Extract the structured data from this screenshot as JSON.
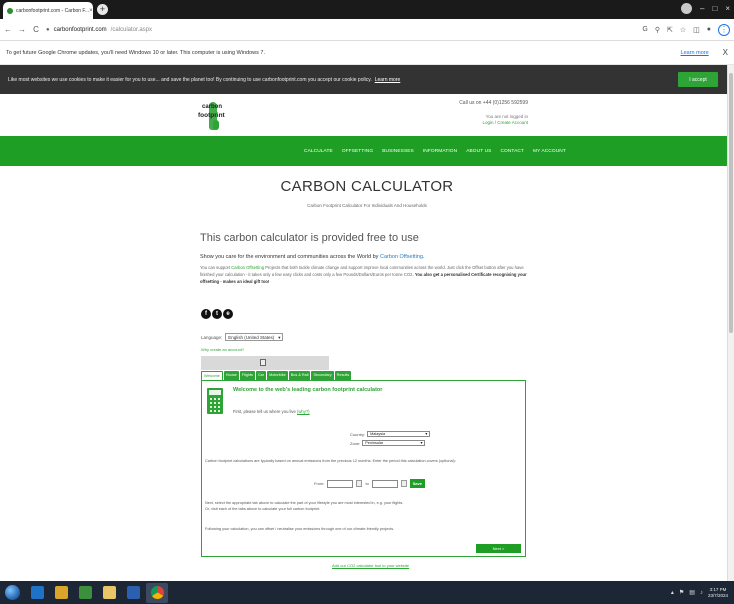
{
  "browser": {
    "tab_title": "carbonfootprint.com - Carbon F...",
    "tab_close": "×",
    "new_tab": "+",
    "url_host": "carbonfootprint.com",
    "url_path": "/calculator.aspx",
    "back": "←",
    "forward": "→",
    "reload": "C",
    "win_min": "–",
    "win_max": "□",
    "win_close": "×",
    "info_message": "To get future Google Chrome updates, you'll need Windows 10 or later. This computer is using Windows 7.",
    "info_learn": "Learn more",
    "info_close": "X"
  },
  "cookie": {
    "message": "Like most websites we use cookies to make it easier for you to use... and save the planet too! By continuing to use carbonfootprint.com you accept our cookie policy.",
    "policy_link": "Learn more",
    "accept": "I accept"
  },
  "header": {
    "logo_line1": "carbon",
    "logo_line2": "footprint",
    "call_us": "Call us on +44 (0)1256 592599",
    "login_status": "You are not logged in",
    "login_links": "Login / Create Account"
  },
  "nav": {
    "items": [
      "CALCULATE",
      "OFFSETTING",
      "BUSINESSES",
      "INFORMATION",
      "ABOUT US",
      "CONTACT",
      "MY ACCOUNT"
    ]
  },
  "page": {
    "title": "CARBON CALCULATOR",
    "subtitle": "Carbon Footprint Calculator For Individuals And Households",
    "heading": "This carbon calculator is provided free to use",
    "lead_a": "Show you care for the environment and communities across the World by ",
    "lead_link": "Carbon Offsetting",
    "lead_b": ".",
    "para_a": "You can support ",
    "para_link": "Carbon Offsetting",
    "para_b": " Projects that both tackle climate change and support improve local communities across the world. Just click the Offset button after you have finished your calculation - it takes only a few easy clicks and costs only a few Pounds/Dollars/Euros per tonne CO2. ",
    "para_bold": "You also get a personalised Certificate recognising your offsetting - makes an ideal gift too!",
    "social": [
      "f",
      "t",
      "e"
    ],
    "language_label": "Language:",
    "language_value": "English (United States)",
    "why_create": "Why create an account?"
  },
  "calculator": {
    "tabs": [
      "Welcome",
      "House",
      "Flights",
      "Car",
      "Motorbike",
      "Bus & Rail",
      "Secondary",
      "Results"
    ],
    "active_tab": "Welcome",
    "welcome_title": "Welcome to the web's leading carbon footprint calculator",
    "first_text": "First, please tell us where you live ",
    "first_link": "(why?)",
    "country_label": "Country:",
    "country_value": "Malaysia",
    "zone_label": "Zone:",
    "zone_value": "Peninsular",
    "para1": "Carbon footprint calculations are typically based on annual emissions from the previous 12 months. Enter the period this calculation covers (optional):",
    "from_label": "From:",
    "to_label": "to",
    "save": "Save",
    "para2_a": "Next, select the appropriate tab above to calculate the part of your lifestyle you are most interested in, e.g. your flights.",
    "para2_b": "Or, visit each of the tabs above to calculate your full carbon footprint.",
    "para3": "Following your calculation, you can offset / neutralise your emissions through one of our climate-friendly projects.",
    "next": "Next >",
    "add_link": "Add our CO2 calculator tool to your website"
  },
  "taskbar": {
    "time": "3:17 PM",
    "date": "23/7/2024"
  }
}
